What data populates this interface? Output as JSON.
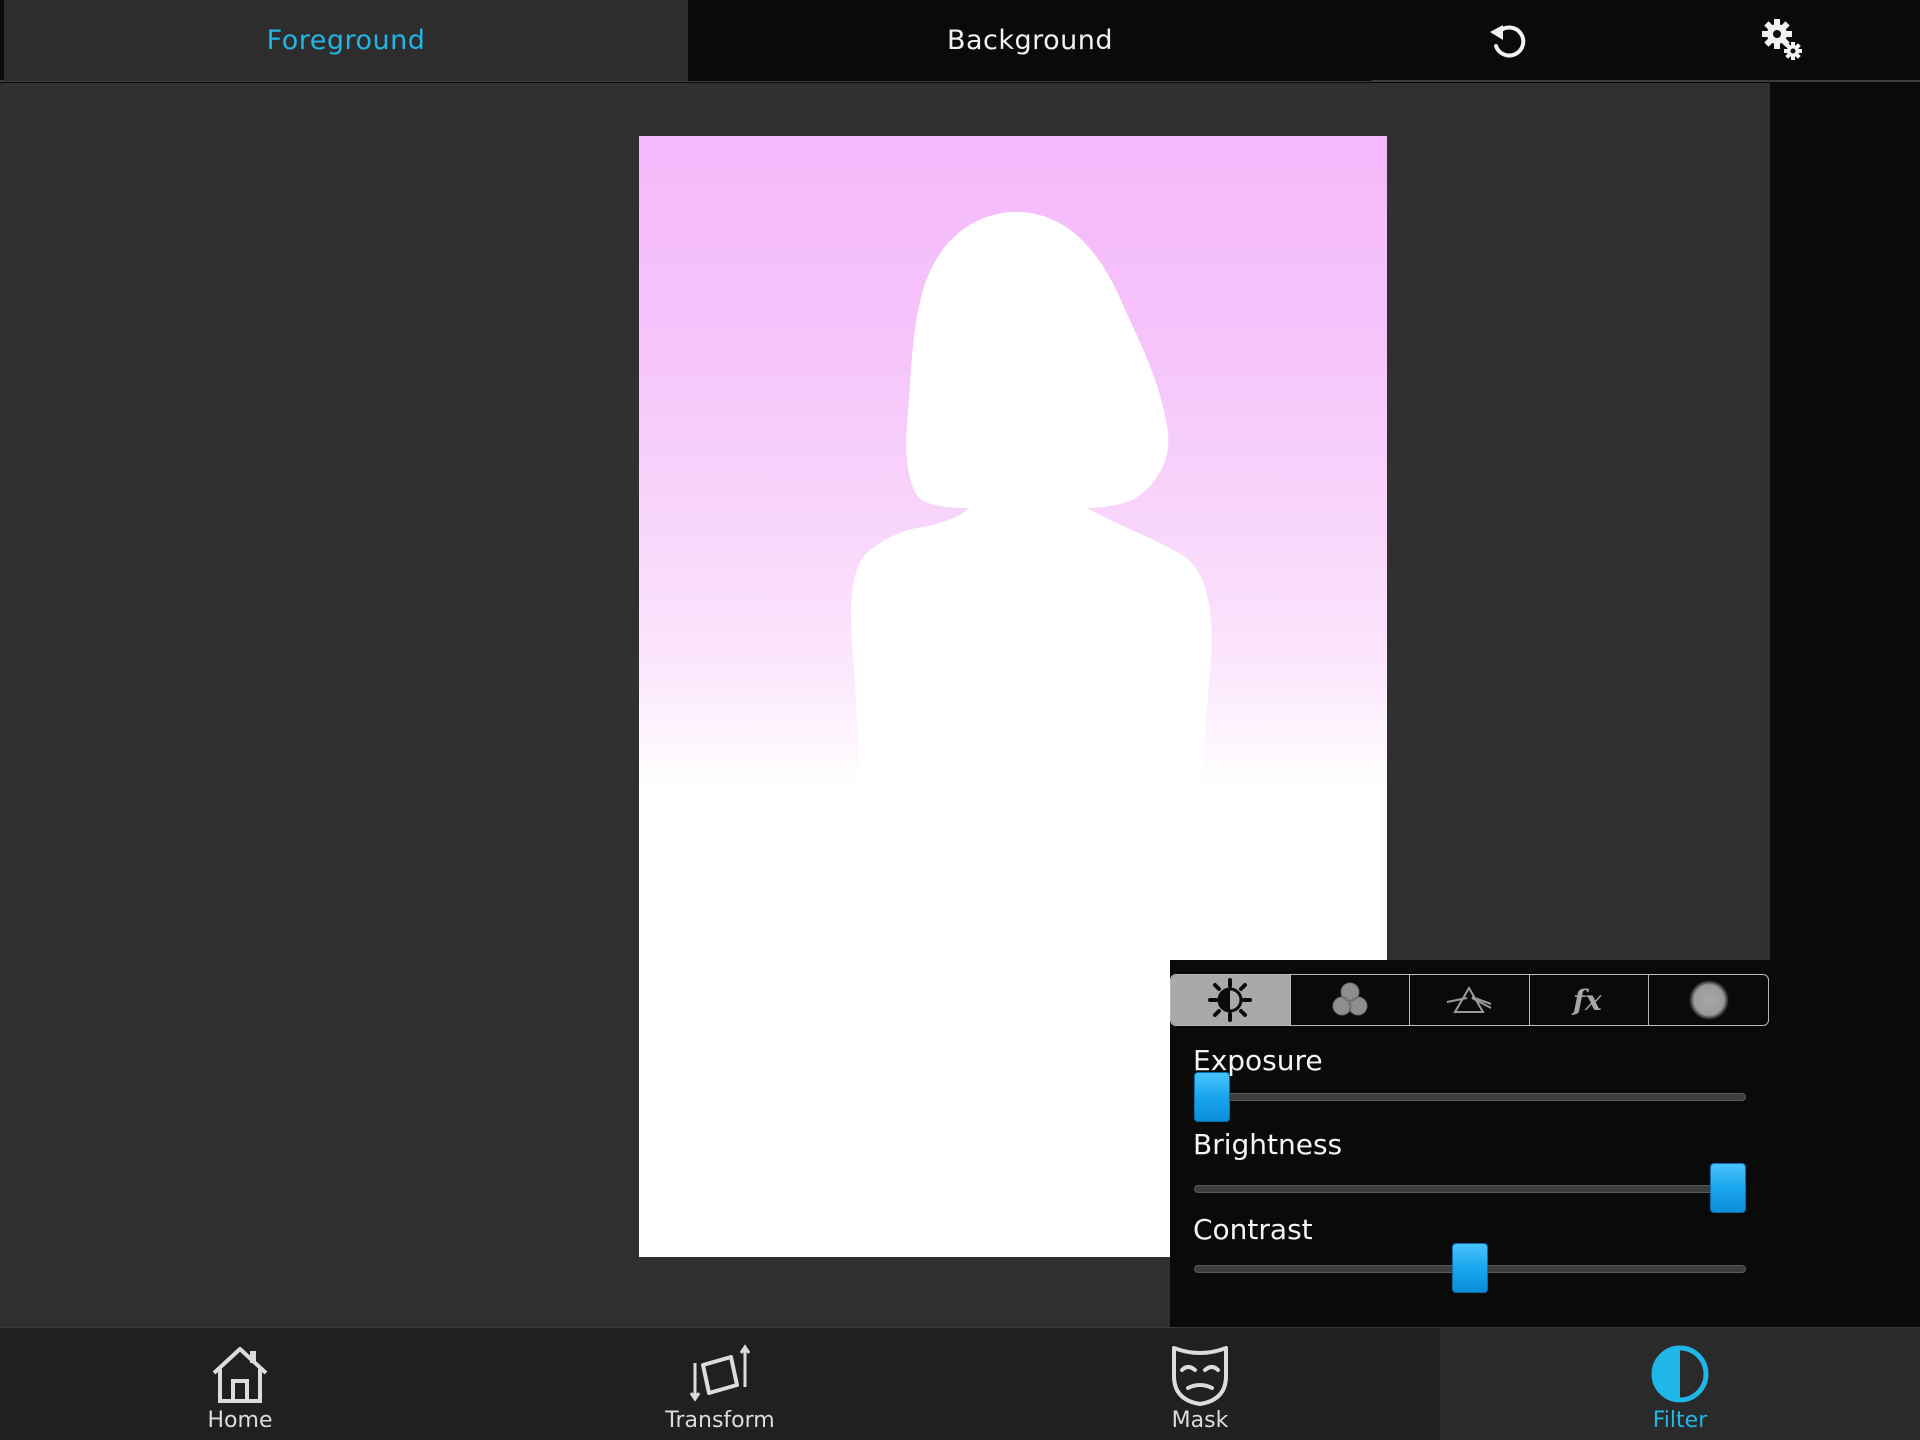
{
  "top_bar": {
    "tabs": [
      {
        "label": "Foreground",
        "active": true
      },
      {
        "label": "Background",
        "active": false
      }
    ],
    "undo_icon": "undo-icon",
    "settings_icon": "gears-icon"
  },
  "filter_panel": {
    "tabs": [
      {
        "icon": "brightness-contrast-icon",
        "active": true
      },
      {
        "icon": "color-channels-icon",
        "active": false
      },
      {
        "icon": "prism-icon",
        "active": false
      },
      {
        "icon": "fx-icon",
        "active": false
      },
      {
        "icon": "blur-dot-icon",
        "active": false
      }
    ],
    "sliders": [
      {
        "label": "Exposure",
        "value": 0.0
      },
      {
        "label": "Brightness",
        "value": 1.0
      },
      {
        "label": "Contrast",
        "value": 0.5
      }
    ]
  },
  "bottom_nav": {
    "items": [
      {
        "label": "Home",
        "icon": "home-icon"
      },
      {
        "label": "Transform",
        "icon": "transform-icon"
      },
      {
        "label": "Mask",
        "icon": "mask-icon"
      },
      {
        "label": "Filter",
        "icon": "filter-icon",
        "active": true
      }
    ]
  },
  "colors": {
    "accent": "#1fb6e8",
    "slider_thumb": "#19a6ef",
    "canvas_bg": "#303030",
    "photo_top": "#f4b9fb"
  }
}
